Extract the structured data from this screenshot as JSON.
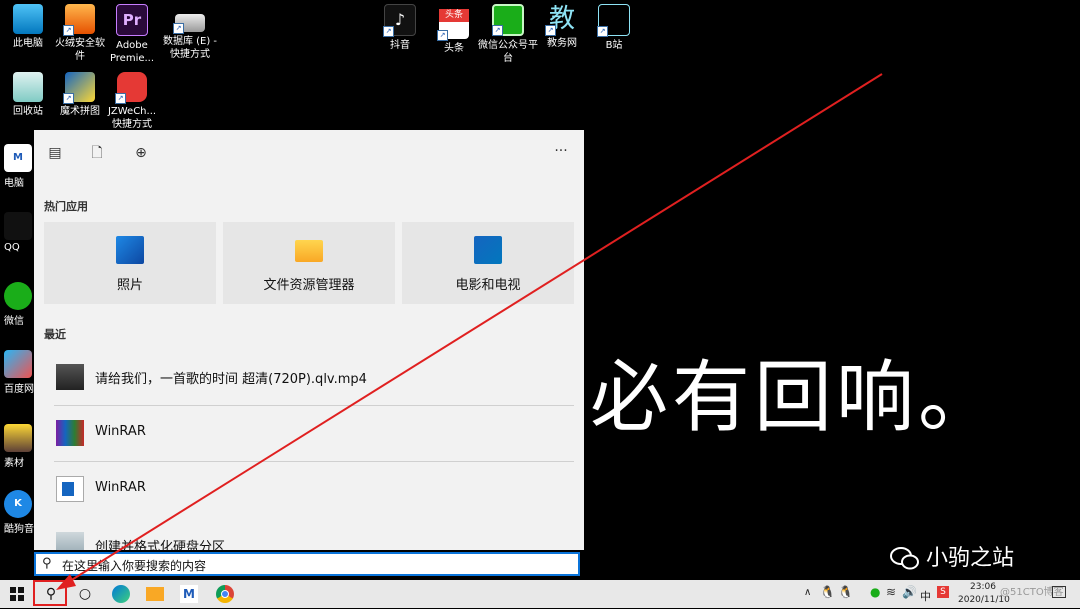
{
  "desktop": {
    "top_icons": [
      {
        "label": "此电脑",
        "icon": "computer-icon"
      },
      {
        "label": "火绒安全软件",
        "icon": "huorong-icon"
      },
      {
        "label": "Adobe Premie...",
        "icon": "premiere-icon"
      },
      {
        "label": "数据库 (E) - 快捷方式",
        "icon": "drive-icon"
      },
      {
        "label": "抖音",
        "icon": "douyin-icon"
      },
      {
        "label": "头条",
        "icon": "toutiao-icon"
      },
      {
        "label": "微信公众号平台",
        "icon": "wechat-mp-icon"
      },
      {
        "label": "教务网",
        "icon": "jiaowu-icon"
      },
      {
        "label": "B站",
        "icon": "bilibili-icon"
      }
    ],
    "second_row": [
      {
        "label": "回收站",
        "icon": "recycle-bin-icon"
      },
      {
        "label": "魔术拼图",
        "icon": "puzzle-icon"
      },
      {
        "label": "JZWeCh... 快捷方式",
        "icon": "jzwechat-icon"
      }
    ],
    "left_partial": [
      {
        "label": "电脑",
        "icon": "pcmgr-icon"
      },
      {
        "label": "QQ",
        "icon": "qq-icon"
      },
      {
        "label": "微信",
        "icon": "wechat-icon"
      },
      {
        "label": "百度网",
        "icon": "baidu-netdisk-icon"
      },
      {
        "label": "素材",
        "icon": "material-icon"
      },
      {
        "label": "酷狗音",
        "icon": "kugou-icon"
      }
    ]
  },
  "panel": {
    "more_label": "···",
    "popular_title": "热门应用",
    "tiles": [
      {
        "label": "照片",
        "icon": "photos-icon"
      },
      {
        "label": "文件资源管理器",
        "icon": "file-explorer-icon"
      },
      {
        "label": "电影和电视",
        "icon": "movies-tv-icon"
      }
    ],
    "recent_title": "最近",
    "recent": [
      {
        "label": "请给我们，一首歌的时间 超清(720P).qlv.mp4",
        "icon": "video-thumb-icon"
      },
      {
        "label": "WinRAR",
        "icon": "winrar-icon"
      },
      {
        "label": "WinRAR",
        "icon": "winrar-window-icon"
      },
      {
        "label": "创建并格式化硬盘分区",
        "icon": "disk-mgmt-icon"
      }
    ]
  },
  "search": {
    "placeholder": "在这里输入你要搜索的内容"
  },
  "overlay": {
    "text": "必有回响。",
    "watermark": "小驹之站"
  },
  "tray": {
    "time": "23:06",
    "date": "2020/11/10",
    "ime": "中",
    "blog": "@51CTO博客"
  },
  "colors": {
    "accent": "#0a74da",
    "highlight": "#e02020"
  }
}
